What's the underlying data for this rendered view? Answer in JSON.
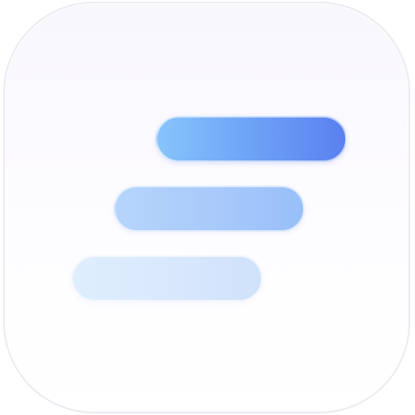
{
  "icon": {
    "name": "stacked-bars-app-icon",
    "background_color": "#f8f7fc",
    "border_color": "#eceaf1",
    "bars": [
      {
        "name": "top-bar",
        "gradient": [
          "#88c4fb",
          "#5a80ef"
        ]
      },
      {
        "name": "middle-bar",
        "gradient": [
          "#b6d5fb",
          "#98bff9"
        ]
      },
      {
        "name": "bottom-bar",
        "gradient": [
          "#dfeefd",
          "#d0e1fb"
        ]
      }
    ]
  }
}
